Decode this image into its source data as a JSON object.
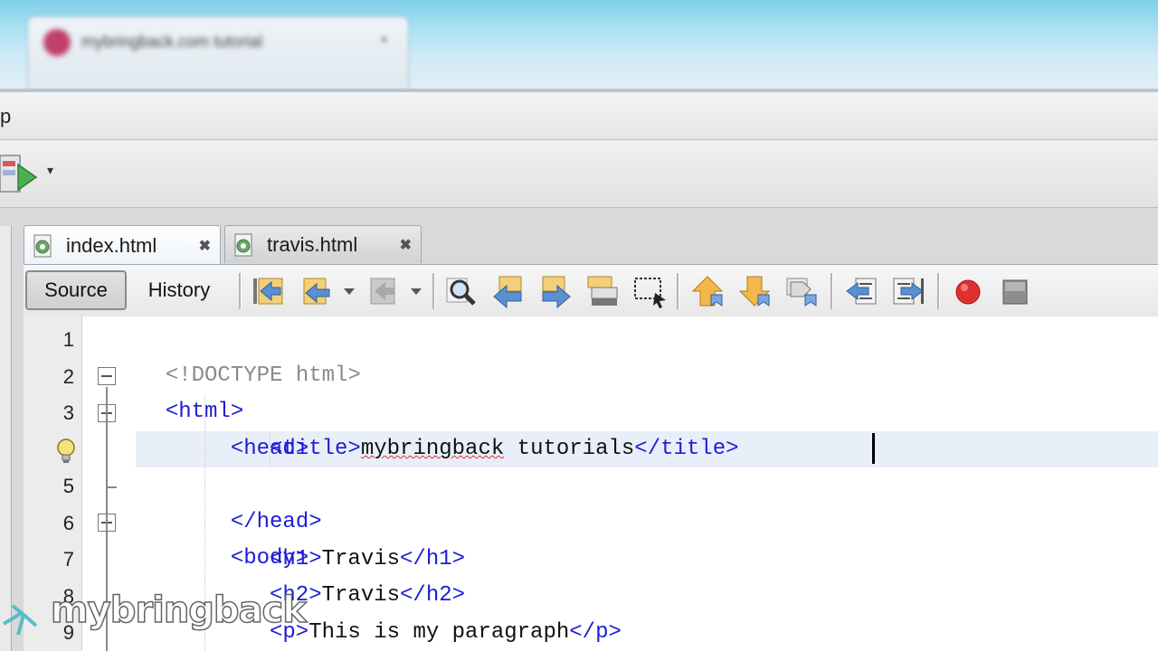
{
  "browser": {
    "tab_title": "mybringback.com tutorial",
    "tab_close": "×"
  },
  "menubar": {
    "visible_text": "p"
  },
  "toolbar": {
    "run_dropdown": "▾"
  },
  "tabs": [
    {
      "label": "index.html",
      "close": "✖",
      "active": true
    },
    {
      "label": "travis.html",
      "close": "✖",
      "active": false
    }
  ],
  "editor_toolbar": {
    "source_label": "Source",
    "history_label": "History",
    "icons": [
      "back-icon",
      "forward-edit-icon",
      "dropdown-icon",
      "next-edit-icon",
      "dropdown-icon",
      "find-icon",
      "find-previous-icon",
      "find-next-icon",
      "toggle-highlight-icon",
      "rectangular-selection-icon",
      "previous-bookmark-icon",
      "next-bookmark-icon",
      "toggle-bookmark-icon",
      "shift-left-icon",
      "shift-right-icon",
      "record-macro-icon",
      "stop-macro-icon"
    ]
  },
  "code": {
    "lines": [
      {
        "num": "1",
        "parts": [
          [
            "doctype",
            "<!DOCTYPE html>"
          ]
        ]
      },
      {
        "num": "2",
        "parts": [
          [
            "tag",
            "<html>"
          ]
        ]
      },
      {
        "num": "3",
        "parts": [
          [
            "tag",
            "<head>"
          ]
        ]
      },
      {
        "num": "",
        "parts": [
          [
            "tag",
            "<title>"
          ],
          [
            "squiggle",
            "mybringback"
          ],
          [
            "text",
            " tutorials"
          ],
          [
            "tag",
            "</title>"
          ]
        ]
      },
      {
        "num": "5",
        "parts": [
          [
            "tag",
            "</head>"
          ]
        ]
      },
      {
        "num": "6",
        "parts": [
          [
            "tag",
            "<body>"
          ]
        ]
      },
      {
        "num": "7",
        "parts": [
          [
            "tag",
            "<h1>"
          ],
          [
            "text",
            "Travis"
          ],
          [
            "tag",
            "</h1>"
          ]
        ]
      },
      {
        "num": "8",
        "parts": [
          [
            "tag",
            "<h2>"
          ],
          [
            "text",
            "Travis"
          ],
          [
            "tag",
            "</h2>"
          ]
        ]
      },
      {
        "num": "9",
        "parts": [
          [
            "tag",
            "<p>"
          ],
          [
            "text",
            "This is my paragraph"
          ],
          [
            "tag",
            "</p>"
          ]
        ]
      }
    ]
  },
  "watermark": {
    "text": "mybringback"
  },
  "colors": {
    "tag": "#1d1dd6",
    "doctype": "#8a8a8a",
    "current_line": "#e9eff8",
    "record": "#e0302e"
  }
}
